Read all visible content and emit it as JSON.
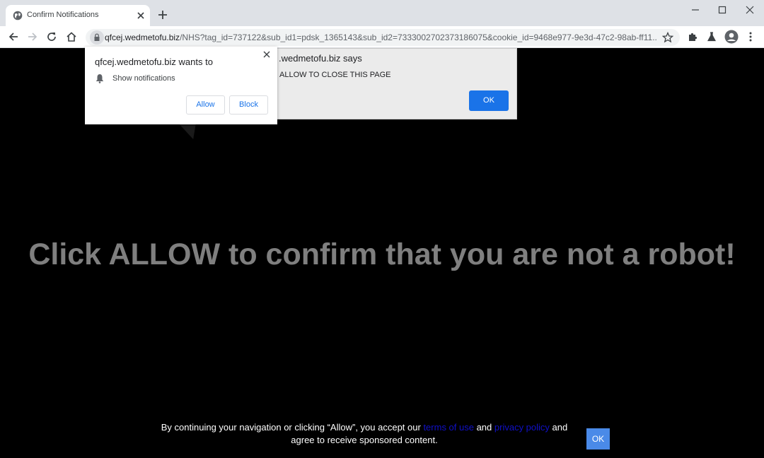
{
  "browser": {
    "tab_title": "Confirm Notifications",
    "url_host": "qfcej.wedmetofu.biz",
    "url_rest": "/NHS?tag_id=737122&sub_id1=pdsk_1365143&sub_id2=7333002702373186075&cookie_id=9468e977-9e3d-47c2-98ab-ff11..."
  },
  "permission_prompt": {
    "title": "qfcej.wedmetofu.biz wants to",
    "description": "Show notifications",
    "allow_label": "Allow",
    "block_label": "Block"
  },
  "alert_dialog": {
    "title": ".wedmetofu.biz says",
    "message": "ALLOW TO CLOSE THIS PAGE",
    "ok_label": "OK"
  },
  "page": {
    "headline": "Click ALLOW to confirm that you are not a robot!",
    "footer": {
      "text_before": "By continuing your navigation or clicking “Allow”, you accept our ",
      "terms_link": "terms of use",
      "and_text": " and ",
      "privacy_link": "privacy policy",
      "text_after": " and agree to receive sponsored content.",
      "ok_label": "OK"
    }
  },
  "colors": {
    "page_background": "#000000",
    "headline": "#7f7f7f",
    "footer_ok": "#4a8ae8",
    "link": "#1010c8",
    "dialog_button": "#1a73e8"
  },
  "icons": {
    "favicon": "globe-icon",
    "tab_close": "close-icon",
    "new_tab": "plus-icon",
    "back": "arrow-left-icon",
    "forward": "arrow-right-icon",
    "reload": "reload-icon",
    "home": "home-icon",
    "lock": "lock-icon",
    "bookmark": "star-icon",
    "extensions": "puzzle-icon",
    "labs": "flask-icon",
    "profile": "avatar-icon",
    "menu": "kebab-menu-icon",
    "notification": "bell-icon"
  }
}
